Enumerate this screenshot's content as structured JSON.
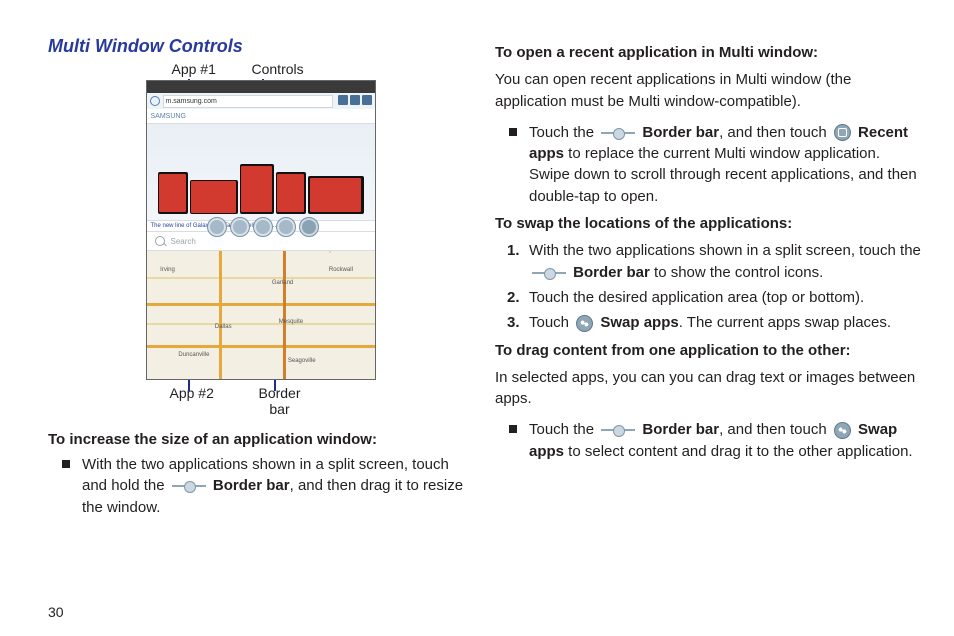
{
  "left": {
    "section_title": "Multi Window Controls",
    "label_app1": "App #1",
    "label_controls": "Controls",
    "label_app2": "App #2",
    "label_border_bar_1": "Border",
    "label_border_bar_2": "bar",
    "url_text": "m.samsung.com",
    "search_placeholder": "Search",
    "link_text": "The new line of Galaxy Pro Tablets deliver mo…",
    "map_cities": {
      "c1": "Irving",
      "c2": "Garland",
      "c3": "Dallas",
      "c4": "Mesquite",
      "c5": "Seagoville",
      "c6": "Rockwall",
      "c7": "Duncanville"
    },
    "h_increase": "To increase the size of an application window:",
    "b_increase_1": "With the two applications shown in a split screen, touch and hold the ",
    "b_increase_bold": "Border bar",
    "b_increase_2": ", and then drag it to resize the window.",
    "page_number": "30"
  },
  "right": {
    "h_open": "To open a recent application in Multi window:",
    "p_open": "You can open recent applications in Multi window (the application must be Multi window-compatible).",
    "b_open_1": "Touch the ",
    "b_open_bold1": "Border bar",
    "b_open_2": ", and then touch ",
    "b_open_bold2": "Recent apps",
    "b_open_3": " to replace the current Multi window application. Swipe down to scroll through recent applications, and then double-tap to open.",
    "h_swap": "To swap the locations of the applications:",
    "s1_a": "With the two applications shown in a split screen, touch the ",
    "s1_bold": "Border bar",
    "s1_b": " to show the control icons.",
    "s2": "Touch the desired application area (top or bottom).",
    "s3_a": "Touch ",
    "s3_bold": "Swap apps",
    "s3_b": ". The current apps swap places.",
    "h_drag": "To drag content from one application to the other:",
    "p_drag": "In selected apps, you can you can drag text or images between apps.",
    "b_drag_1": "Touch the ",
    "b_drag_bold1": "Border bar",
    "b_drag_2": ", and then touch ",
    "b_drag_bold2": "Swap apps",
    "b_drag_3": " to select content and drag it to the other application."
  }
}
